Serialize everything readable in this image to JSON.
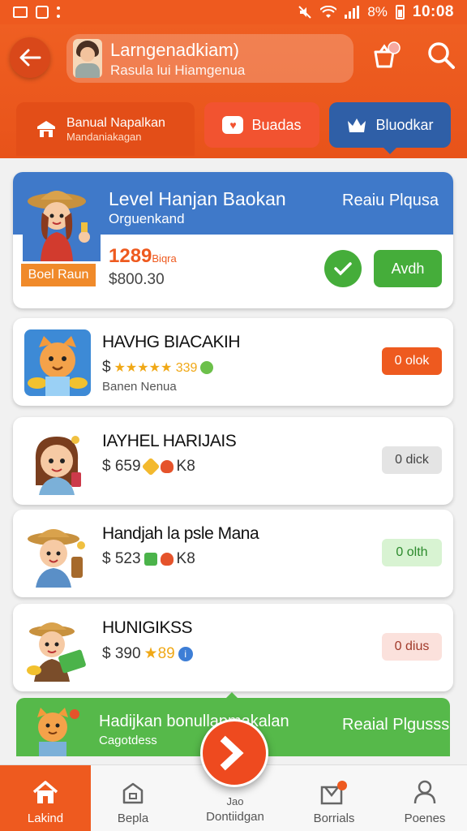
{
  "status_bar": {
    "battery": "8%",
    "time": "10:08"
  },
  "header": {
    "profile_name": "Larngenadkiam)",
    "profile_subtitle": "Rasula lui Hiamgenua"
  },
  "tabs": [
    {
      "label": "Banual Napalkan",
      "sublabel": "Mandaniakagan"
    },
    {
      "label": "Buadas"
    },
    {
      "label": "Bluodkar"
    }
  ],
  "featured": {
    "title": "Level Hanjan Baokan",
    "subtitle": "Orguenkand",
    "right_label": "Reaiu Plqusa",
    "ribbon": "Boel Raun",
    "price": "1289",
    "price_suffix": "Biqra",
    "amount": "$800.30",
    "action_label": "Avdh"
  },
  "items": [
    {
      "name": "HAVHG BIACAKIH",
      "price": "$",
      "stars_value": "★★★★★ 339",
      "extra": "Banen Nenua",
      "action": "0 olok"
    },
    {
      "name": "IAYHEL HARIJAIS",
      "price": "$ 659",
      "stars_value": "K8",
      "extra": "",
      "action": "0 dick"
    },
    {
      "name": "Handjah la psle Mana",
      "price": "$ 523",
      "stars_value": "K8",
      "extra": "",
      "action": "0 olth"
    },
    {
      "name": "HUNIGIKSS",
      "price": "$ 390",
      "stars_value": "★89",
      "extra": "",
      "action": "0 dius"
    }
  ],
  "promo": {
    "title": "Hadijkan bonullapmakalan",
    "subtitle": "Cagotdess",
    "right_label": "Reaial Plgusss"
  },
  "bottom_nav": [
    {
      "label": "Lakind"
    },
    {
      "label": "Bepla"
    },
    {
      "label": "Dontiidgan",
      "top_label": "Jao"
    },
    {
      "label": "Borrials"
    },
    {
      "label": "Poenes"
    }
  ],
  "colors": {
    "brand": "#ee5a1f",
    "blue": "#3f79c9",
    "green": "#45ad3a"
  },
  "icons": [
    "back-arrow-icon",
    "cart-icon",
    "search-icon",
    "shop-icon",
    "heart-chat-icon",
    "crown-icon",
    "like-icon",
    "play-arrow-icon",
    "home-icon",
    "bag-icon",
    "gift-icon",
    "person-icon"
  ]
}
